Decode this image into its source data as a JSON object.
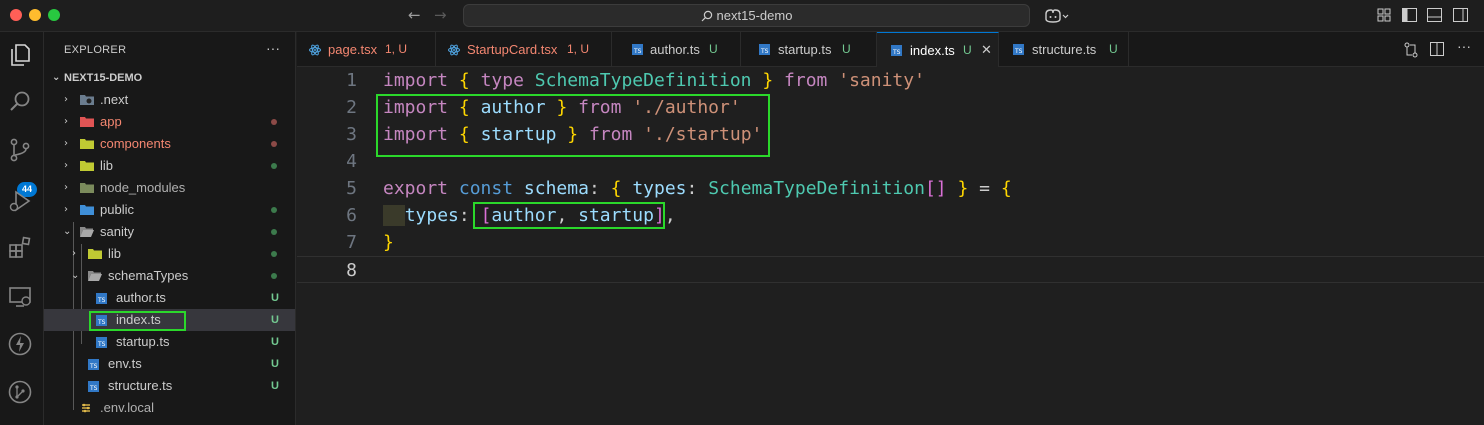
{
  "titlebar": {
    "search_text": "next15-demo",
    "nav_back": "←",
    "nav_forward": "→"
  },
  "activity_bar": {
    "items": [
      {
        "icon": "files-icon"
      },
      {
        "icon": "search-icon"
      },
      {
        "icon": "source-control-icon",
        "badge": "44"
      },
      {
        "icon": "run-debug-icon"
      },
      {
        "icon": "extensions-icon"
      },
      {
        "icon": "remote-explorer-icon"
      },
      {
        "icon": "lightning-icon"
      },
      {
        "icon": "git-graph-icon"
      }
    ]
  },
  "sidebar": {
    "title": "EXPLORER",
    "more": "···",
    "project": "NEXT15-DEMO",
    "items": [
      {
        "label": ".next",
        "status": "",
        "color": "#cccccc"
      },
      {
        "label": "app",
        "status": "dot",
        "color": "#f48771"
      },
      {
        "label": "components",
        "status": "dot",
        "color": "#f48771"
      },
      {
        "label": "lib",
        "status": "dot",
        "color": "#cccccc"
      },
      {
        "label": "node_modules",
        "status": "",
        "color": "#cccccc"
      },
      {
        "label": "public",
        "status": "dot",
        "color": "#cccccc"
      },
      {
        "label": "sanity",
        "status": "dot",
        "color": "#cccccc"
      },
      {
        "label": "lib",
        "status": "dot",
        "color": "#cccccc"
      },
      {
        "label": "schemaTypes",
        "status": "dot",
        "color": "#cccccc"
      },
      {
        "label": "author.ts",
        "status": "U",
        "color": "#cccccc"
      },
      {
        "label": "index.ts",
        "status": "U",
        "color": "#cccccc"
      },
      {
        "label": "startup.ts",
        "status": "U",
        "color": "#cccccc"
      },
      {
        "label": "env.ts",
        "status": "U",
        "color": "#cccccc"
      },
      {
        "label": "structure.ts",
        "status": "U",
        "color": "#cccccc"
      },
      {
        "label": ".env.local",
        "status": "",
        "color": "#cccccc"
      }
    ]
  },
  "tabs": [
    {
      "label": "page.tsx",
      "status": "1, U",
      "color": "#f48771"
    },
    {
      "label": "StartupCard.tsx",
      "status": "1, U",
      "color": "#f48771"
    },
    {
      "label": "author.ts",
      "status": "U",
      "color": "#cccccc"
    },
    {
      "label": "startup.ts",
      "status": "U",
      "color": "#cccccc"
    },
    {
      "label": "index.ts",
      "status": "U",
      "color": "#cccccc",
      "close": "✕"
    },
    {
      "label": "structure.ts",
      "status": "U",
      "color": "#cccccc"
    }
  ],
  "editor": {
    "line_numbers": [
      "1",
      "2",
      "3",
      "4",
      "5",
      "6",
      "7",
      "8"
    ],
    "lines": [
      [
        [
          "kw",
          "import"
        ],
        [
          "",
          " "
        ],
        [
          "br1",
          "{"
        ],
        [
          "",
          " "
        ],
        [
          "kw",
          "type"
        ],
        [
          "",
          " "
        ],
        [
          "typ",
          "SchemaTypeDefinition"
        ],
        [
          "",
          " "
        ],
        [
          "br1",
          "}"
        ],
        [
          "",
          " "
        ],
        [
          "kw",
          "from"
        ],
        [
          "",
          " "
        ],
        [
          "str",
          "'sanity'"
        ]
      ],
      [
        [
          "kw",
          "import"
        ],
        [
          "",
          " "
        ],
        [
          "br1",
          "{"
        ],
        [
          "",
          " "
        ],
        [
          "var",
          "author"
        ],
        [
          "",
          " "
        ],
        [
          "br1",
          "}"
        ],
        [
          "",
          " "
        ],
        [
          "kw",
          "from"
        ],
        [
          "",
          " "
        ],
        [
          "str",
          "'./author'"
        ]
      ],
      [
        [
          "kw",
          "import"
        ],
        [
          "",
          " "
        ],
        [
          "br1",
          "{"
        ],
        [
          "",
          " "
        ],
        [
          "var",
          "startup"
        ],
        [
          "",
          " "
        ],
        [
          "br1",
          "}"
        ],
        [
          "",
          " "
        ],
        [
          "kw",
          "from"
        ],
        [
          "",
          " "
        ],
        [
          "str",
          "'./startup'"
        ]
      ],
      [],
      [
        [
          "kw",
          "export"
        ],
        [
          "",
          " "
        ],
        [
          "kw2",
          "const"
        ],
        [
          "",
          " "
        ],
        [
          "var",
          "schema"
        ],
        [
          "",
          ": "
        ],
        [
          "br1",
          "{"
        ],
        [
          "",
          " "
        ],
        [
          "var",
          "types"
        ],
        [
          "",
          ": "
        ],
        [
          "typ",
          "SchemaTypeDefinition"
        ],
        [
          "br2",
          "[]"
        ],
        [
          "",
          " "
        ],
        [
          "br1",
          "}"
        ],
        [
          "",
          " = "
        ],
        [
          "br1",
          "{"
        ]
      ],
      [
        [
          "ident-bg",
          "  "
        ],
        [
          "var",
          "types"
        ],
        [
          "",
          ": "
        ],
        [
          "br2",
          "["
        ],
        [
          "var",
          "author"
        ],
        [
          "",
          ", "
        ],
        [
          "var",
          "startup"
        ],
        [
          "br2",
          "]"
        ],
        [
          "",
          ","
        ]
      ],
      [
        [
          "br1",
          "}"
        ]
      ],
      []
    ]
  }
}
